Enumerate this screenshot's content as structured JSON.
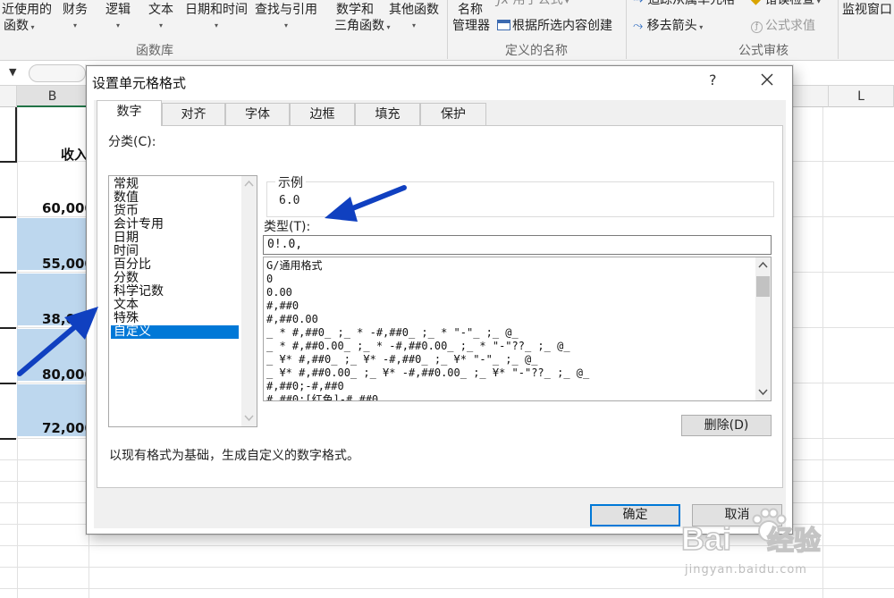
{
  "ribbon": {
    "recent_functions": "近使用的",
    "recent_functions_sub": "函数",
    "finance": "财务",
    "logic": "逻辑",
    "text": "文本",
    "datetime": "日期和时间",
    "lookup": "查找与引用",
    "math": "数学和",
    "math_sub": "三角函数",
    "other": "其他函数",
    "name_manager": "名称",
    "name_manager_sub": "管理器",
    "use_in_formula": "用于公式",
    "create_from_selection": "根据所选内容创建",
    "trace_dependents": "追踪从属单元格",
    "error_checking": "错误检查",
    "watch_window": "监视窗口",
    "remove_arrows": "移去箭头",
    "evaluate_formula": "公式求值",
    "group_function_library": "函数库",
    "group_defined_names": "定义的名称",
    "group_formula_auditing": "公式审核"
  },
  "sheet": {
    "col_b": "B",
    "col_l": "L",
    "header_text": "收入",
    "values": [
      "60,000",
      "55,000",
      "38,000",
      "80,000",
      "72,000"
    ]
  },
  "dialog": {
    "title": "设置单元格格式",
    "help": "?",
    "tabs": [
      {
        "label": "数字"
      },
      {
        "label": "对齐"
      },
      {
        "label": "字体"
      },
      {
        "label": "边框"
      },
      {
        "label": "填充"
      },
      {
        "label": "保护"
      }
    ],
    "category_label": "分类(C):",
    "categories": [
      {
        "label": "常规"
      },
      {
        "label": "数值"
      },
      {
        "label": "货币"
      },
      {
        "label": "会计专用"
      },
      {
        "label": "日期"
      },
      {
        "label": "时间"
      },
      {
        "label": "百分比"
      },
      {
        "label": "分数"
      },
      {
        "label": "科学记数"
      },
      {
        "label": "文本"
      },
      {
        "label": "特殊"
      },
      {
        "label": "自定义",
        "selected": true
      }
    ],
    "sample_label": "示例",
    "sample_value": "6.0",
    "type_label": "类型(T):",
    "type_value": "0!.0,",
    "formats": [
      "G/通用格式",
      "0",
      "0.00",
      "#,##0",
      "#,##0.00",
      "_ * #,##0_ ;_ * -#,##0_ ;_ * \"-\"_ ;_ @_",
      "_ * #,##0.00_ ;_ * -#,##0.00_ ;_ * \"-\"??_ ;_ @_",
      "_ ¥* #,##0_ ;_ ¥* -#,##0_ ;_ ¥* \"-\"_ ;_ @_",
      "_ ¥* #,##0.00_ ;_ ¥* -#,##0.00_ ;_ ¥* \"-\"??_ ;_ @_",
      "#,##0;-#,##0",
      "#,##0;[红色]-#,##0"
    ],
    "delete_button": "删除(D)",
    "description": "以现有格式为基础，生成自定义的数字格式。",
    "ok_button": "确定",
    "cancel_button": "取消"
  },
  "watermark": {
    "brand": "Bai",
    "brand_cn": "经验",
    "url": "jingyan.baidu.com"
  },
  "colors": {
    "selection": "#0078d7",
    "cell_fill": "#bdd7ee",
    "annotation_arrow": "#1040c0"
  }
}
